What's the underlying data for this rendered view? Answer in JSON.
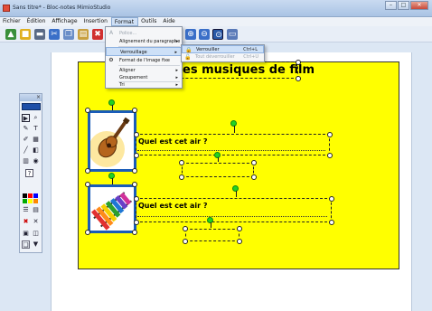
{
  "window": {
    "title": "Sans titre* - Bloc-notes MimioStudio",
    "controls": {
      "minimize": "–",
      "maximize": "□",
      "close": "✕"
    }
  },
  "menubar": {
    "items": [
      "Fichier",
      "Édition",
      "Affichage",
      "Insertion",
      "Format",
      "Outils",
      "Aide"
    ],
    "active": "Format"
  },
  "format_menu": {
    "items": [
      {
        "label": "Police...",
        "icon": "font-icon",
        "enabled": false,
        "submenu": false
      },
      {
        "label": "Alignement du paragraphe",
        "enabled": true,
        "submenu": true
      },
      {
        "label": "Verrouillage",
        "enabled": true,
        "submenu": true,
        "highlighted": true
      },
      {
        "label": "Format de l'image fixe",
        "icon": "image-format-icon",
        "enabled": true,
        "submenu": false
      },
      {
        "label": "Aligner",
        "enabled": true,
        "submenu": true
      },
      {
        "label": "Groupement",
        "enabled": true,
        "submenu": true
      },
      {
        "label": "Tri",
        "enabled": true,
        "submenu": true
      }
    ]
  },
  "lock_submenu": {
    "items": [
      {
        "label": "Verrouiller",
        "shortcut": "Ctrl+L",
        "icon": "lock-icon",
        "enabled": true,
        "highlighted": true
      },
      {
        "label": "Tout déverrouiller",
        "shortcut": "Ctrl+U",
        "icon": "unlock-icon",
        "enabled": false
      }
    ]
  },
  "slide": {
    "title": "es musiques de film",
    "questions": [
      {
        "label": "Quel est cet air ?",
        "image": "guitar"
      },
      {
        "label": "Quel est cet air ?",
        "image": "xylophone"
      }
    ],
    "background_color": "#ffff00"
  },
  "palette": {
    "colors": [
      "#000000",
      "#ff0000",
      "#0000ff",
      "#00aa00",
      "#ffff00",
      "#ff8800",
      "#ffffff",
      "#888888"
    ]
  }
}
